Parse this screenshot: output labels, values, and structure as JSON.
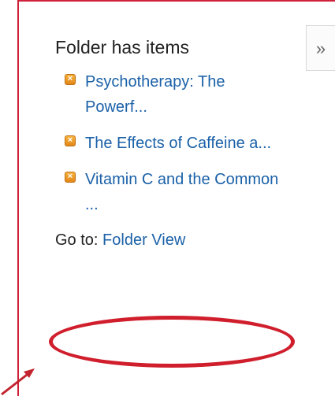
{
  "panel": {
    "title": "Folder has items",
    "collapse_glyph": "»",
    "items": [
      {
        "label": "Psychotherapy: The Powerf...",
        "icon": "orange-x-icon"
      },
      {
        "label": "The Effects of Caffeine a...",
        "icon": "orange-x-icon"
      },
      {
        "label": "Vitamin C and the Common ...",
        "icon": "orange-x-icon"
      }
    ],
    "goto_label": "Go to:",
    "goto_link": "Folder View"
  },
  "colors": {
    "link": "#1b61a8",
    "annotation_red": "#d01e2c",
    "icon_orange": "#e2871a"
  }
}
